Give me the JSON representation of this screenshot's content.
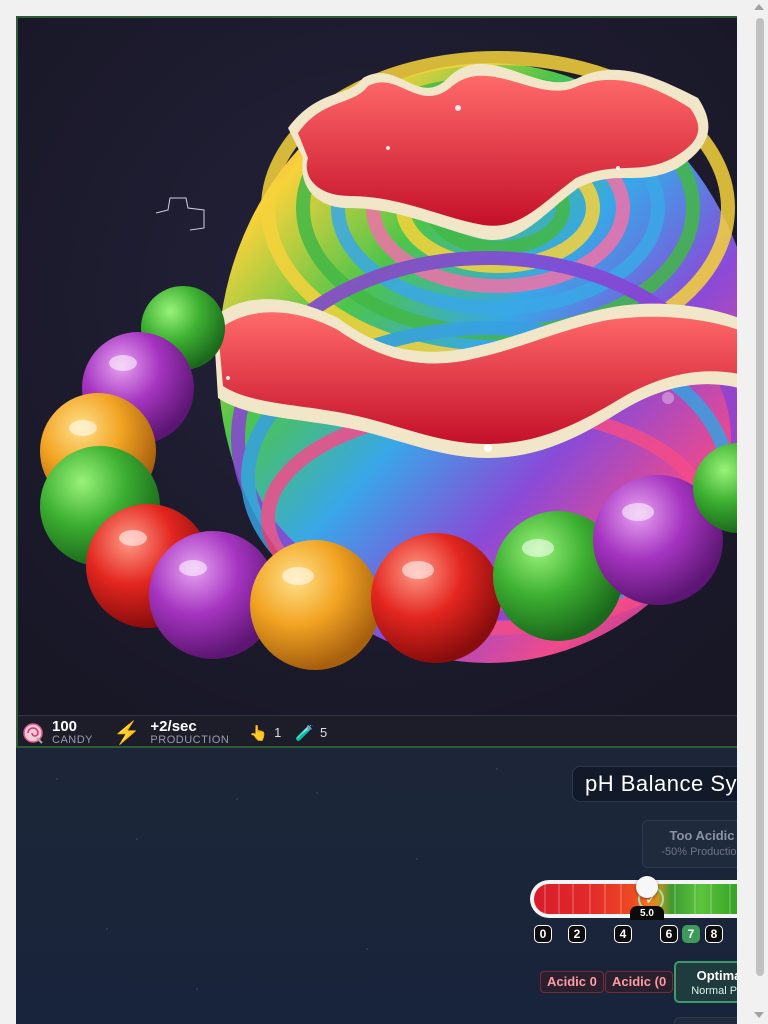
{
  "stats": {
    "candy_value": "100",
    "candy_label": "CANDY",
    "production_value": "+2/sec",
    "production_label": "PRODUCTION",
    "clicks_value": "1",
    "potions_value": "5",
    "candy_icon": "lollipop-icon",
    "production_icon": "lightning-icon",
    "clicks_icon": "pointing-hand-icon",
    "potions_icon": "test-tube-icon"
  },
  "ph": {
    "title": "pH Balance Sy",
    "too_acidic_title": "Too Acidic",
    "too_acidic_desc": "-50% Production",
    "ticks": [
      "0",
      "2",
      "4",
      "6",
      "7",
      "8"
    ],
    "active_tick": "7",
    "current_value_label": "5.0",
    "chip1": "Acidic 0",
    "chip2": "Acidic (0",
    "optimal_title": "Optima",
    "optimal_desc": "Normal Pro"
  },
  "colors": {
    "frame_border": "#2f5a36",
    "stats_bg": "#1d1d2a",
    "panel_bg": "#1b2539",
    "accent_green": "#3d9a5a",
    "chip_red": "#ff9aa5"
  }
}
